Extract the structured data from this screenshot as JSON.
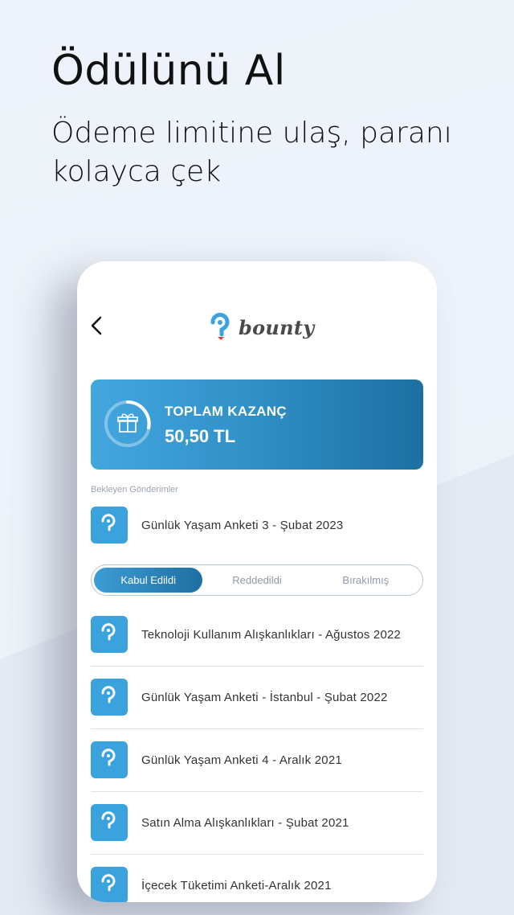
{
  "promo": {
    "headline": "Ödülünü Al",
    "subline": "Ödeme limitine ulaş, paranı kolayca çek"
  },
  "header": {
    "back_icon": "chevron-left-icon",
    "logo_text": "bounty"
  },
  "earnings": {
    "title": "TOPLAM KAZANÇ",
    "value": "50,50 TL",
    "icon": "gift-icon"
  },
  "pending": {
    "label": "Bekleyen Gönderimler",
    "items": [
      {
        "title": "Günlük Yaşam Anketi 3 - Şubat 2023"
      }
    ]
  },
  "tabs": [
    {
      "label": "Kabul Edildi",
      "active": true
    },
    {
      "label": "Reddedildi",
      "active": false
    },
    {
      "label": "Bırakılmış",
      "active": false
    }
  ],
  "accepted": [
    {
      "title": "Teknoloji Kullanım Alışkanlıkları - Ağustos 2022"
    },
    {
      "title": "Günlük Yaşam Anketi - İstanbul - Şubat 2022"
    },
    {
      "title": "Günlük Yaşam Anketi 4 - Aralık 2021"
    },
    {
      "title": "Satın Alma Alışkanlıkları - Şubat 2021"
    },
    {
      "title": "İçecek Tüketimi Anketi-Aralık 2021"
    }
  ],
  "colors": {
    "accent": "#3aa3dd",
    "card_dark": "#1d6fa3"
  }
}
